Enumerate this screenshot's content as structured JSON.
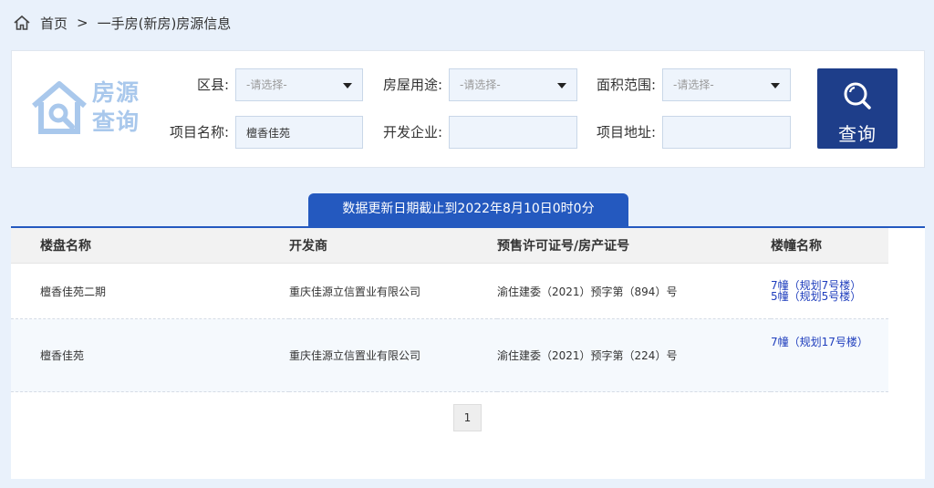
{
  "breadcrumb": {
    "home": "首页",
    "separator": ">",
    "current": "一手房(新房)房源信息"
  },
  "logo": {
    "line1": "房源",
    "line2": "查询"
  },
  "filters": {
    "district_label": "区县:",
    "district_value": "-请选择-",
    "usage_label": "房屋用途:",
    "usage_value": "-请选择-",
    "area_label": "面积范围:",
    "area_value": "-请选择-",
    "project_label": "项目名称:",
    "project_value": "檀香佳苑",
    "developer_label": "开发企业:",
    "developer_value": "",
    "address_label": "项目地址:",
    "address_value": ""
  },
  "search_button": {
    "label": "查询",
    "icon": "search-icon"
  },
  "update_notice": "数据更新日期截止到2022年8月10日0时0分",
  "table": {
    "headers": [
      "楼盘名称",
      "开发商",
      "预售许可证号/房产证号",
      "楼幢名称"
    ],
    "rows": [
      {
        "name": "檀香佳苑二期",
        "developer": "重庆佳源立信置业有限公司",
        "permit": "渝住建委（2021）预字第（894）号",
        "buildings": [
          "7幢（规划7号楼）",
          "5幢（规划5号楼）"
        ]
      },
      {
        "name": "檀香佳苑",
        "developer": "重庆佳源立信置业有限公司",
        "permit": "渝住建委（2021）预字第（224）号",
        "buildings": [
          "7幢（规划17号楼）"
        ]
      }
    ]
  },
  "pagination": {
    "current_page": "1"
  },
  "colors": {
    "accent": "#2459bf",
    "button": "#1e3e8a",
    "link": "#1f3ebd",
    "logo": "#a9c8ec"
  }
}
